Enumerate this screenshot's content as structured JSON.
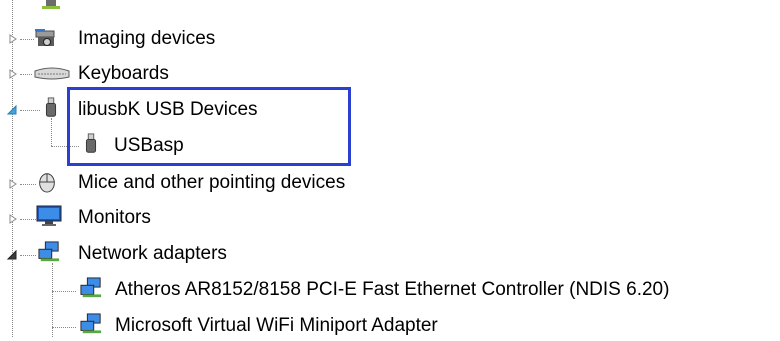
{
  "tree": {
    "items": [
      {
        "label": "Imaging devices",
        "icon": "camera-scanner-icon",
        "expanded": false
      },
      {
        "label": "Keyboards",
        "icon": "keyboard-icon",
        "expanded": false
      },
      {
        "label": "libusbK USB Devices",
        "icon": "usb-plug-icon",
        "expanded": true,
        "children": [
          {
            "label": "USBasp",
            "icon": "usb-plug-icon"
          }
        ]
      },
      {
        "label": "Mice and other pointing devices",
        "icon": "mouse-icon",
        "expanded": false
      },
      {
        "label": "Monitors",
        "icon": "monitor-icon",
        "expanded": false
      },
      {
        "label": "Network adapters",
        "icon": "network-adapter-icon",
        "expanded": true,
        "children": [
          {
            "label": "Atheros AR8152/8158 PCI-E Fast Ethernet Controller (NDIS 6.20)",
            "icon": "network-adapter-icon"
          },
          {
            "label": "Microsoft Virtual WiFi Miniport Adapter",
            "icon": "network-adapter-icon"
          }
        ]
      }
    ]
  },
  "highlight": {
    "color": "#2b3fd1"
  }
}
